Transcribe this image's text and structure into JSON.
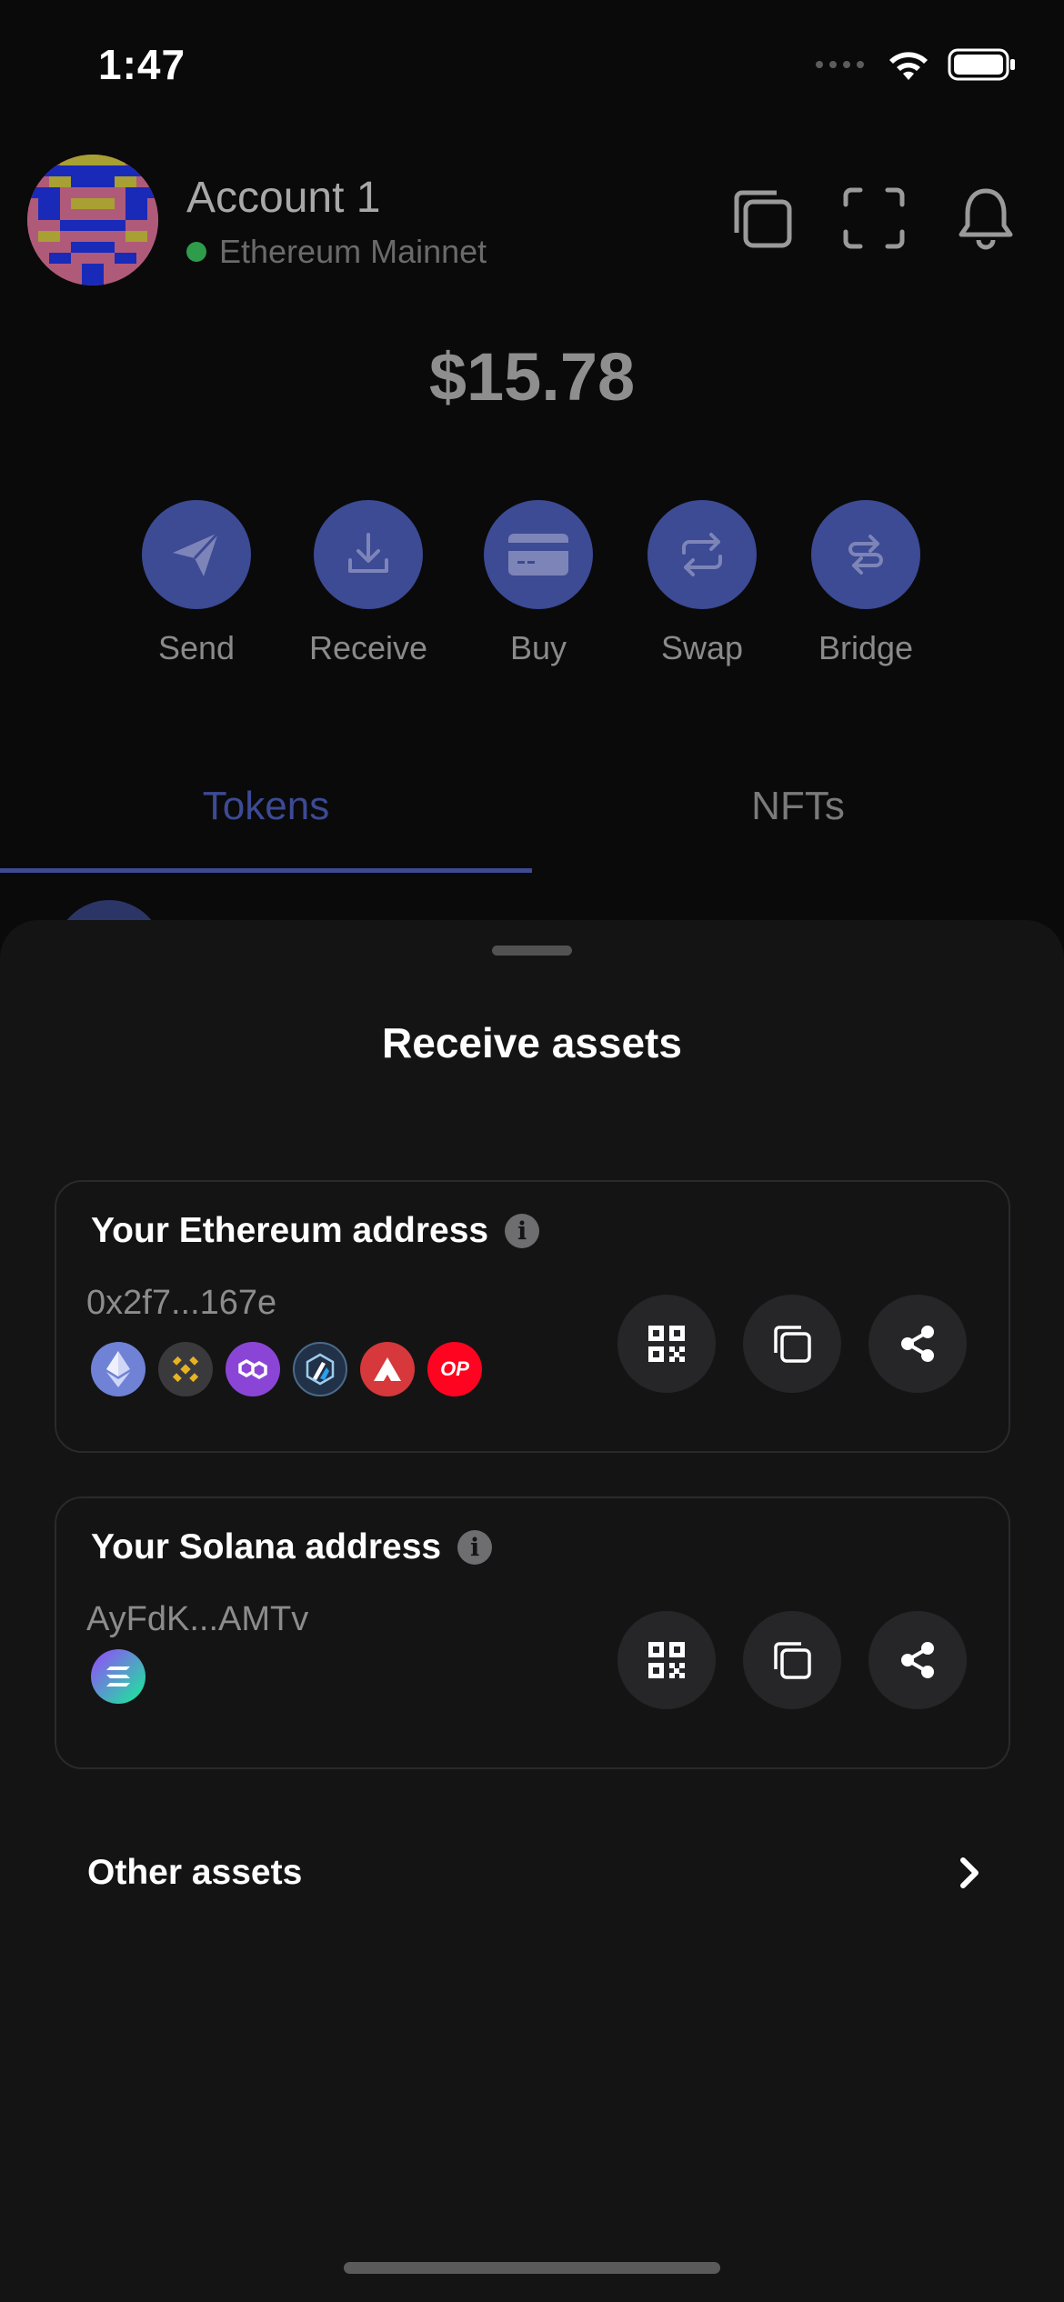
{
  "status_bar": {
    "time": "1:47"
  },
  "header": {
    "account_name": "Account 1",
    "network": "Ethereum Mainnet",
    "network_status_color": "#2e9c4a",
    "icons": [
      "copy-icon",
      "scan-icon",
      "bell-icon"
    ]
  },
  "balance": "$15.78",
  "actions": [
    {
      "label": "Send",
      "icon": "send-icon"
    },
    {
      "label": "Receive",
      "icon": "download-icon"
    },
    {
      "label": "Buy",
      "icon": "card-icon"
    },
    {
      "label": "Swap",
      "icon": "swap-icon"
    },
    {
      "label": "Bridge",
      "icon": "bridge-icon"
    }
  ],
  "tabs": [
    {
      "label": "Tokens",
      "active": true
    },
    {
      "label": "NFTs",
      "active": false
    }
  ],
  "sheet": {
    "title": "Receive assets",
    "cards": [
      {
        "title": "Your Ethereum address",
        "address": "0x2f7...167e",
        "chains": [
          "ethereum",
          "bnb-chain",
          "polygon",
          "arbitrum",
          "avalanche",
          "optimism"
        ],
        "optimism_badge": "OP"
      },
      {
        "title": "Your Solana address",
        "address": "AyFdK...AMTv",
        "chains": [
          "solana"
        ]
      }
    ],
    "info_glyph": "i",
    "other_assets": "Other assets"
  },
  "colors": {
    "accent": "#3d4a94",
    "sheet_bg": "#141415",
    "background": "#0a0a0a"
  }
}
